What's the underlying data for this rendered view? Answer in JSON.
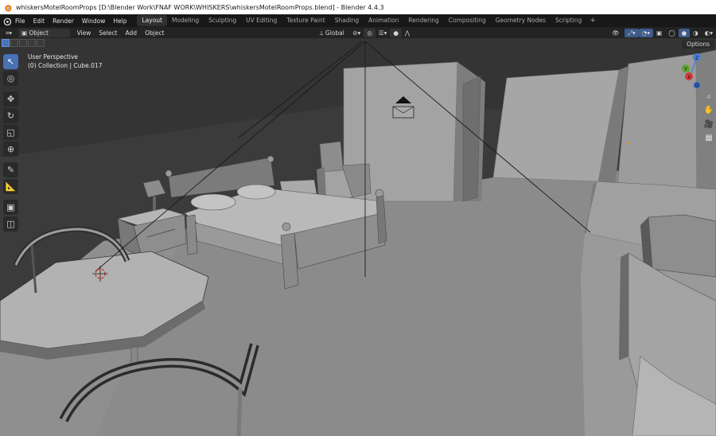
{
  "window": {
    "title": "whiskersMotelRoomProps [D:\\Blender Work\\FNAF WORK\\WHISKERS\\whiskersMotelRoomProps.blend] - Blender 4.4.3"
  },
  "menu": [
    "File",
    "Edit",
    "Render",
    "Window",
    "Help"
  ],
  "workspaces": [
    {
      "label": "Layout",
      "active": true
    },
    {
      "label": "Modeling",
      "active": false
    },
    {
      "label": "Sculpting",
      "active": false
    },
    {
      "label": "UV Editing",
      "active": false
    },
    {
      "label": "Texture Paint",
      "active": false
    },
    {
      "label": "Shading",
      "active": false
    },
    {
      "label": "Animation",
      "active": false
    },
    {
      "label": "Rendering",
      "active": false
    },
    {
      "label": "Compositing",
      "active": false
    },
    {
      "label": "Geometry Nodes",
      "active": false
    },
    {
      "label": "Scripting",
      "active": false
    }
  ],
  "add_tab": "+",
  "header": {
    "mode": "Object Mode",
    "menus": [
      "View",
      "Select",
      "Add",
      "Object"
    ],
    "transform_orientation": "Global"
  },
  "viewport": {
    "perspective": "User Perspective",
    "collection": "(0) Collection | Cube.017",
    "options_label": "Options",
    "bg_color": "#3c3c3c",
    "floor_color": "#8c8c8c"
  },
  "gizmo": {
    "z": "Z",
    "y": "Y",
    "x": "X"
  },
  "toolbar": [
    {
      "icon": "select-box-icon",
      "glyph": "↖",
      "active": true
    },
    {
      "icon": "cursor-icon",
      "glyph": "◎",
      "active": false
    },
    {
      "icon": "move-icon",
      "glyph": "✥",
      "active": false
    },
    {
      "icon": "rotate-icon",
      "glyph": "↻",
      "active": false
    },
    {
      "icon": "scale-icon",
      "glyph": "◱",
      "active": false
    },
    {
      "icon": "transform-icon",
      "glyph": "⊕",
      "active": false
    },
    {
      "icon": "annotate-icon",
      "glyph": "✎",
      "active": false
    },
    {
      "icon": "measure-icon",
      "glyph": "📐",
      "active": false
    },
    {
      "icon": "add-cube-icon",
      "glyph": "▣",
      "active": false
    },
    {
      "icon": "add-mesh-icon",
      "glyph": "◫",
      "active": false
    }
  ]
}
